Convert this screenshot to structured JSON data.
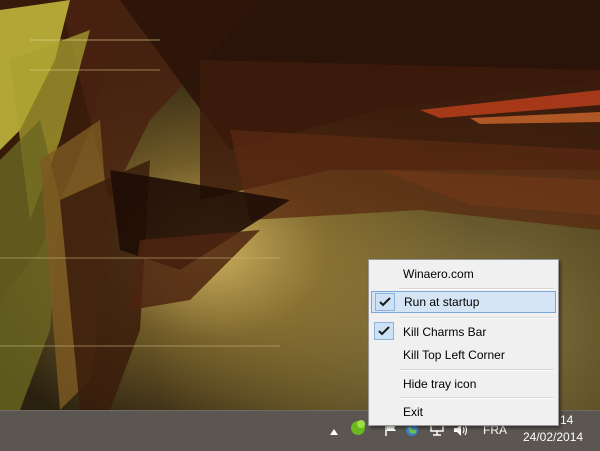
{
  "desktop": {
    "wallpaper": "abstract-spiky-wallpaper"
  },
  "context_menu": {
    "items": [
      {
        "label": "Winaero.com",
        "checked": false,
        "highlighted": false
      },
      {
        "label": "Run at startup",
        "checked": true,
        "highlighted": true
      },
      {
        "label": "Kill Charms Bar",
        "checked": true,
        "highlighted": false
      },
      {
        "label": "Kill Top Left Corner",
        "checked": false,
        "highlighted": false
      },
      {
        "label": "Hide tray icon",
        "checked": false,
        "highlighted": false
      },
      {
        "label": "Exit",
        "checked": false,
        "highlighted": false
      }
    ]
  },
  "taskbar": {
    "tray_icons": [
      "show-hidden-icons-arrow",
      "winaero-app-icon",
      "action-center-flag-icon",
      "network-globe-icon",
      "network-monitor-icon",
      "volume-icon"
    ],
    "language": "FRA",
    "time": "14",
    "date": "24/02/2014"
  },
  "colors": {
    "menu_bg": "#f0f0f0",
    "menu_highlight": "#d5e5f5",
    "menu_highlight_border": "#7aa7d6",
    "taskbar_bg": "#5b5651"
  }
}
